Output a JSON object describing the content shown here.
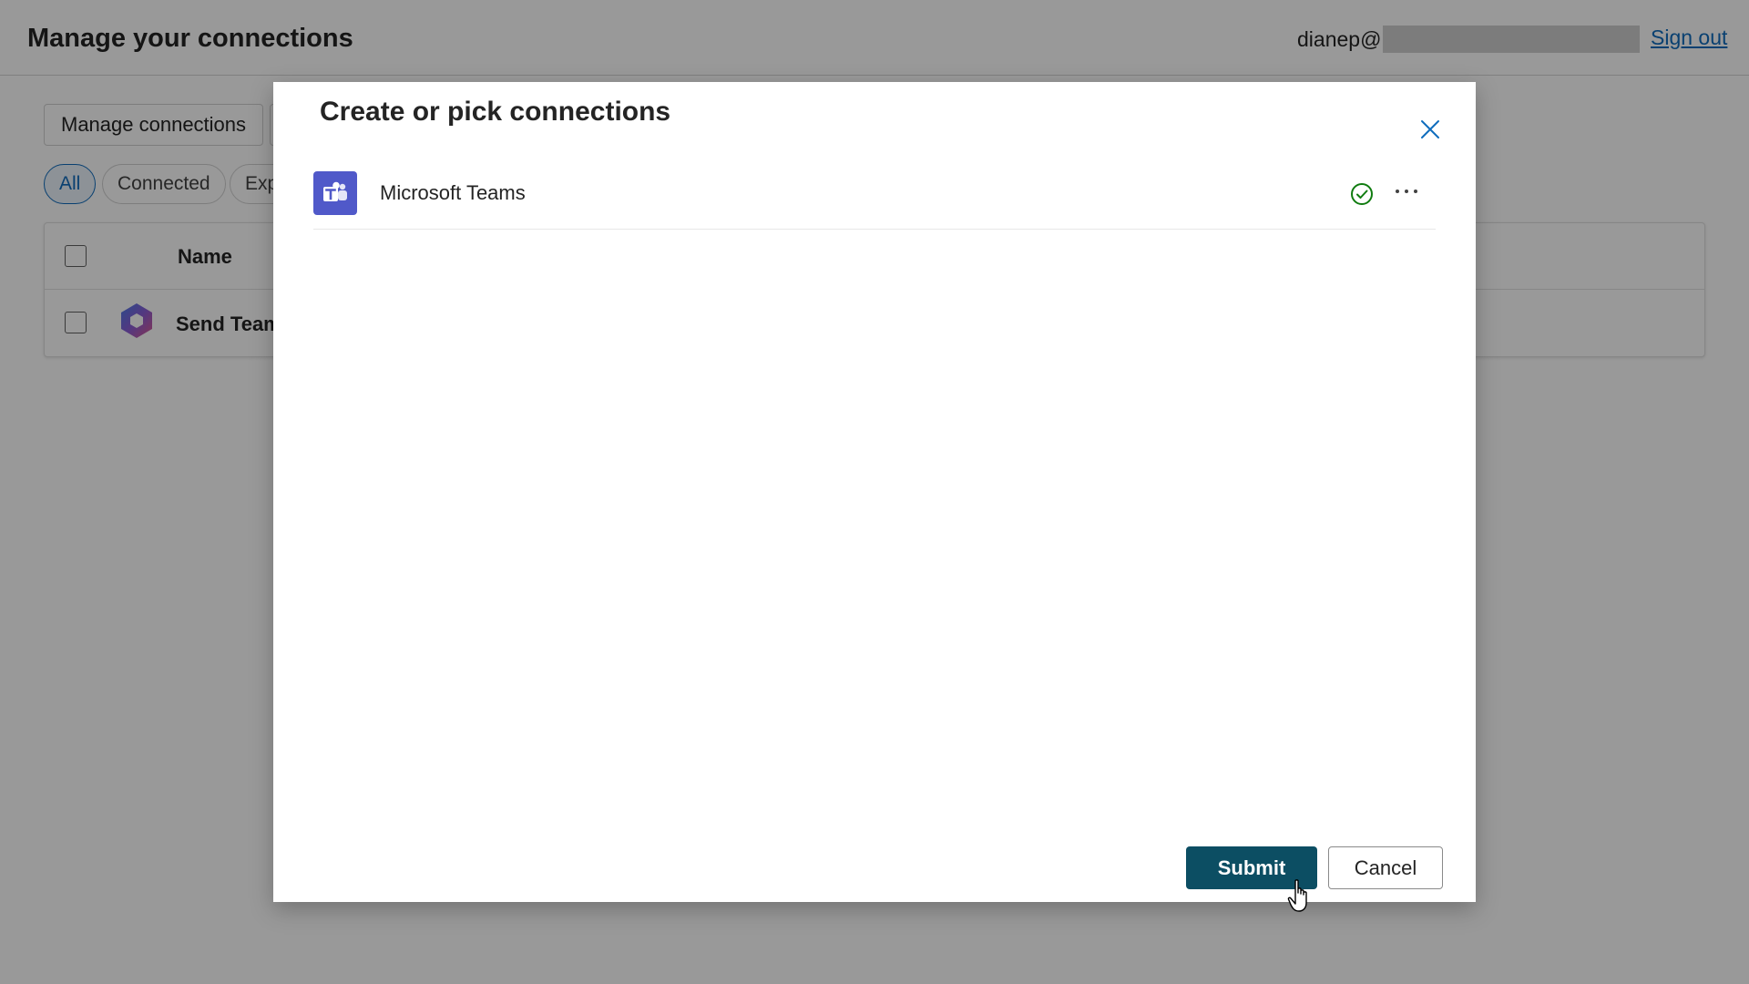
{
  "header": {
    "title": "Manage your connections",
    "user_prefix": "dianep@",
    "sign_out": "Sign out"
  },
  "toolbar": {
    "manage_connections": "Manage connections"
  },
  "filters": [
    {
      "label": "All",
      "active": true
    },
    {
      "label": "Connected",
      "active": false
    },
    {
      "label": "Exp",
      "active": false
    }
  ],
  "table": {
    "columns": {
      "name": "Name"
    },
    "rows": [
      {
        "name": "Send Teams"
      }
    ]
  },
  "dialog": {
    "title": "Create or pick connections",
    "connections": [
      {
        "name": "Microsoft Teams",
        "status_icon": "check-circle-icon",
        "status_color": "#107c10"
      }
    ],
    "submit_label": "Submit",
    "cancel_label": "Cancel"
  },
  "colors": {
    "primary": "#0c4e63",
    "teams": "#5059c9",
    "link": "#0f6cbd",
    "success": "#107c10"
  }
}
